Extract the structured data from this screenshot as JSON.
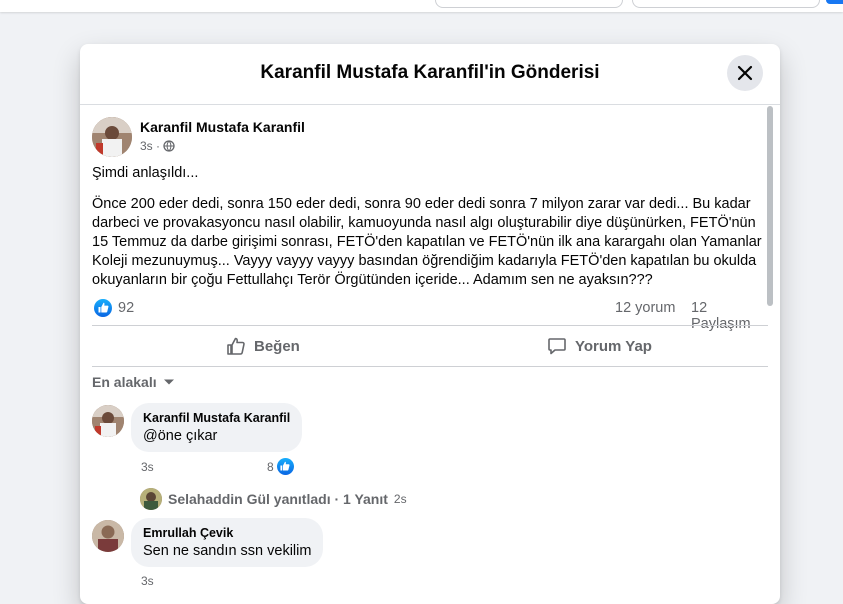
{
  "modal": {
    "title": "Karanfil Mustafa Karanfil'in Gönderisi"
  },
  "post": {
    "author": "Karanfil Mustafa Karanfil",
    "time": "3s ·",
    "line1": "Şimdi anlaşıldı...",
    "body": "Önce 200 eder dedi, sonra 150 eder dedi, sonra 90 eder dedi sonra 7 milyon zarar var dedi... Bu kadar darbeci ve provakasyoncu nasıl olabilir, kamuoyunda nasıl algı oluşturabilir diye düşünürken, FETÖ'nün 15 Temmuz da darbe girişimi sonrası, FETÖ'den kapatılan ve FETÖ'nün ilk ana karargahı olan Yamanlar Koleji mezunuymuş... Vayyy vayyy vayyy basından öğrendiğim kadarıyla FETÖ'den kapatılan bu okulda okuyanların bir çoğu Fettullahçı Terör Örgütünden içeride... Adamım sen ne ayaksın???",
    "reactions": "92",
    "comments": "12 yorum",
    "shares": "12 Paylaşım"
  },
  "actions": {
    "like": "Beğen",
    "comment": "Yorum Yap"
  },
  "sort": {
    "label": "En alakalı"
  },
  "comments": [
    {
      "author": "Karanfil Mustafa Karanfil",
      "text": "@öne çıkar",
      "time": "3s",
      "likes": "8"
    },
    {
      "author": "Emrullah Çevik",
      "text": "Sen ne sandın ssn vekilim",
      "time": "3s"
    }
  ],
  "reply_summary": {
    "text": "Selahaddin Gül yanıtladı · 1 Yanıt",
    "time": "2s"
  },
  "colors": {
    "accent": "#1877f2",
    "muted": "#65676b",
    "bubble": "#f0f2f5"
  }
}
